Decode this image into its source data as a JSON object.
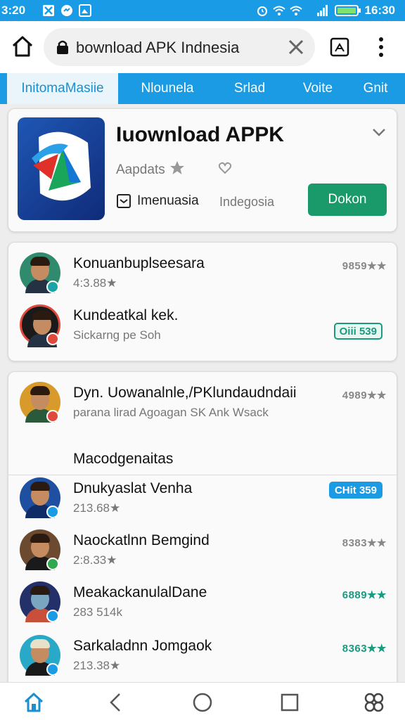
{
  "status_bar": {
    "time_left": "3:20",
    "time_right": "16:30",
    "icons": [
      "tools-icon",
      "messenger-icon",
      "gallery-icon",
      "alarm-icon",
      "wifi-icon",
      "signal-icon",
      "battery-icon"
    ]
  },
  "address_bar": {
    "url": "bownload APK Indnesia"
  },
  "tabs": [
    {
      "label": "InitomaMasiie",
      "active": true
    },
    {
      "label": "Nlounela",
      "active": false
    },
    {
      "label": "Srlad",
      "active": false
    },
    {
      "label": "Voite",
      "active": false
    },
    {
      "label": "Gnit",
      "active": false
    }
  ],
  "featured": {
    "title": "Iuownload APPK",
    "subtitle": "Aapdats",
    "region": "Imenuasia",
    "country": "Indegosia",
    "install_label": "Dokon"
  },
  "card1": {
    "rows": [
      {
        "name": "Konuanbuplseesara",
        "meta": "4:3.88★",
        "rating": "9859★★",
        "badge_color": "#1ba3a6"
      },
      {
        "name": "Kundeatkal kek.",
        "meta": "Sickarng pe Soh",
        "pill": "Oiii 539",
        "badge_color": "#e04a3c"
      }
    ]
  },
  "card2": {
    "header": {
      "name": "Dyn. Uowanalnle,/PKlundaudndaii",
      "meta": "parana lirad Agoagan SK Ank Wsack",
      "rating": "4989★★",
      "badge_color": "#e04a3c"
    },
    "section_title": "Macodgenaitas",
    "rows": [
      {
        "name": "Dnukyaslat Venha",
        "meta": "213.68★",
        "pill": "CHit 359",
        "badge_color": "#1b9be3"
      },
      {
        "name": "Naockatlnn Bemgind",
        "meta": "2:8.33★",
        "rating": "8383★★",
        "badge_color": "#2fa84f"
      },
      {
        "name": "MeakackanulalDane",
        "meta": "283 514k",
        "rating": "6889★★",
        "rating_green": true,
        "badge_color": "#1b9be3"
      },
      {
        "name": "Sarkaladnn Jomgaok",
        "meta": "213.38★",
        "rating": "8363★★",
        "rating_green": true,
        "badge_color": "#1b9be3"
      }
    ]
  },
  "colors": {
    "accent": "#1b9be3",
    "install": "#1a9a6a",
    "rating_green": "#1a9a80"
  },
  "bottom_nav": [
    "home-icon",
    "back-icon",
    "circle-home-icon",
    "recents-icon",
    "settings-icon"
  ]
}
